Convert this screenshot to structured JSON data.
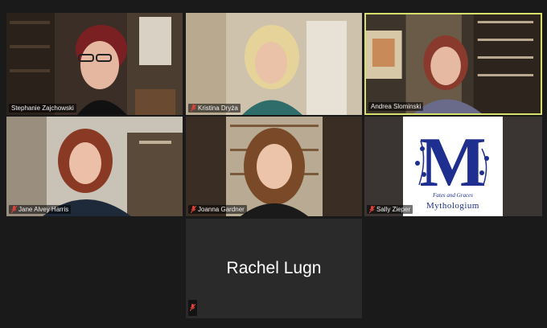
{
  "participants": [
    {
      "name": "Stephanie Zajchowski",
      "muted": false
    },
    {
      "name": "Kristina Dryża",
      "muted": true
    },
    {
      "name": "Andrea Slominski",
      "muted": false,
      "active_speaker": true
    },
    {
      "name": "Jane Alvey Harris",
      "muted": true
    },
    {
      "name": "Joanna Gardner",
      "muted": true
    },
    {
      "name": "Sally Zieper",
      "muted": true,
      "logo": {
        "letter": "M",
        "tagline": "Fates and Graces",
        "wordmark": "Mythologium"
      }
    },
    {
      "name": "Rachel Lugn",
      "muted": true,
      "video_off": true
    }
  ],
  "colors": {
    "background": "#1a1a1a",
    "active_border": "#d6e06a",
    "muted_icon": "#e0413a",
    "logo_blue": "#1f2f8f"
  }
}
